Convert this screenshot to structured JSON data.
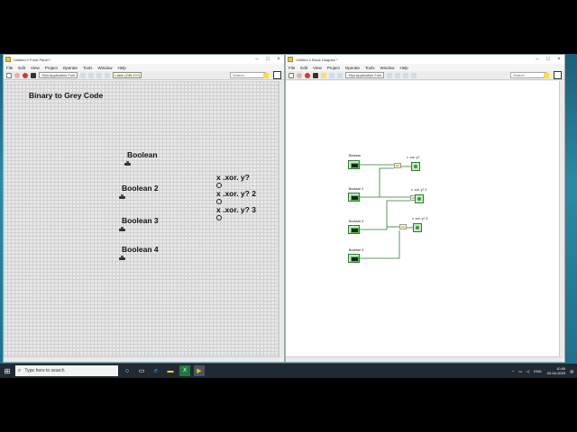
{
  "front_panel": {
    "title": "Untitled 2 Front Panel *",
    "menu": [
      "File",
      "Edit",
      "View",
      "Project",
      "Operate",
      "Tools",
      "Window",
      "Help"
    ],
    "font": "15pt Application Font",
    "coords": "Lable (246,107)",
    "search_placeholder": "Search",
    "heading": "Binary to Grey Code",
    "controls": [
      "Boolean",
      "Boolean 2",
      "Boolean 3",
      "Boolean 4"
    ],
    "indicators": [
      "x .xor. y?",
      "x .xor. y? 2",
      "x .xor. y? 3"
    ]
  },
  "block_diagram": {
    "title": "Untitled 2 Block Diagram *",
    "menu": [
      "File",
      "Edit",
      "View",
      "Project",
      "Operate",
      "Tools",
      "Window",
      "Help"
    ],
    "font": "15pt Application Font",
    "search_placeholder": "Search",
    "controls": [
      "Boolean",
      "Boolean 2",
      "Boolean 3",
      "Boolean 4"
    ],
    "indicators": [
      "x .xor. y?",
      "x .xor. y? 2",
      "x .xor. y? 3"
    ],
    "xor_glyph": "xor"
  },
  "taskbar": {
    "search_placeholder": "Type here to search",
    "language": "ENG",
    "time": "10:50",
    "date": "02-04-2023"
  },
  "colors": {
    "wire_green": "#2e7d32",
    "terminal_bg": "#c8e8c8",
    "taskbar": "#1f2a33"
  }
}
